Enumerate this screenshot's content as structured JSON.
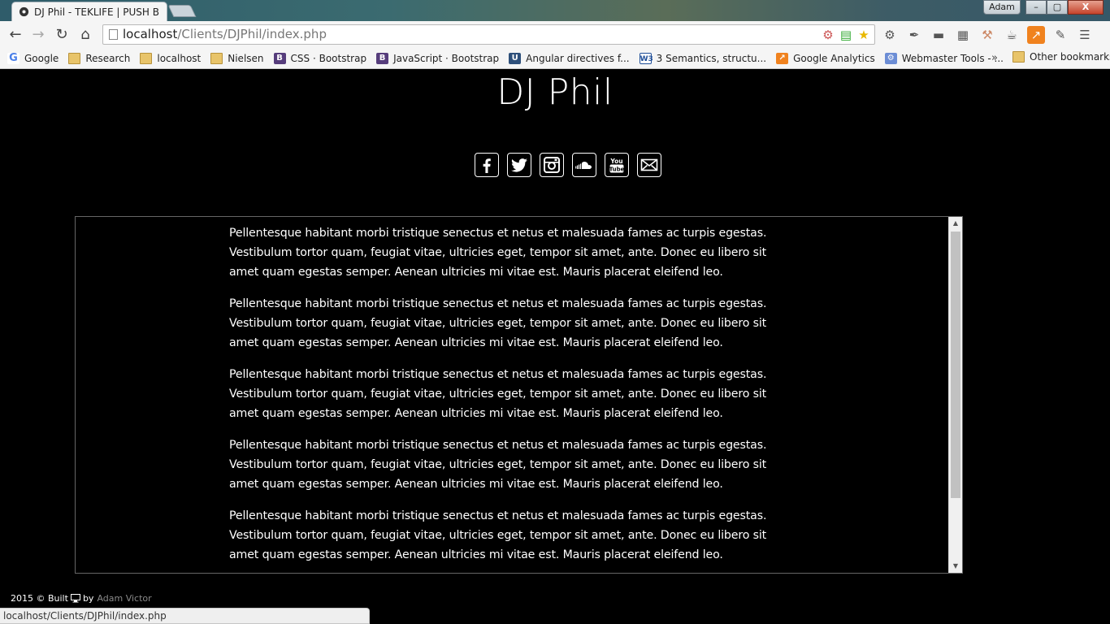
{
  "browser": {
    "tab_title": "DJ Phil - TEKLIFE | PUSH B",
    "profile_name": "Adam",
    "window_buttons": {
      "minimize": "–",
      "maximize": "▢",
      "close": "X"
    },
    "url_host": "localhost",
    "url_path": "/Clients/DJPhil/index.php",
    "bookmarks": [
      {
        "label": "Google",
        "icon": "google-icon"
      },
      {
        "label": "Research",
        "icon": "folder-icon"
      },
      {
        "label": "localhost",
        "icon": "folder-icon"
      },
      {
        "label": "Nielsen",
        "icon": "folder-icon"
      },
      {
        "label": "CSS · Bootstrap",
        "icon": "bootstrap-icon"
      },
      {
        "label": "JavaScript · Bootstrap",
        "icon": "bootstrap-icon"
      },
      {
        "label": "Angular directives f...",
        "icon": "angular-icon"
      },
      {
        "label": "3 Semantics, structu...",
        "icon": "w3-icon"
      },
      {
        "label": "Google Analytics",
        "icon": "analytics-icon"
      },
      {
        "label": "Webmaster Tools - ...",
        "icon": "webmaster-icon"
      }
    ],
    "bookmarks_overflow": "»",
    "other_bookmarks": "Other bookmarks",
    "status_url": "localhost/Clients/DJPhil/index.php"
  },
  "page": {
    "title": "DJ Phil",
    "social": [
      {
        "name": "facebook-icon",
        "glyph": "f"
      },
      {
        "name": "twitter-icon",
        "glyph": "twitter"
      },
      {
        "name": "instagram-icon",
        "glyph": "instagram"
      },
      {
        "name": "soundcloud-icon",
        "glyph": "soundcloud"
      },
      {
        "name": "youtube-icon",
        "glyph": "youtube"
      },
      {
        "name": "email-icon",
        "glyph": "mail"
      }
    ],
    "paragraphs": [
      "Pellentesque habitant morbi tristique senectus et netus et malesuada fames ac turpis egestas. Vestibulum tortor quam, feugiat vitae, ultricies eget, tempor sit amet, ante. Donec eu libero sit amet quam egestas semper. Aenean ultricies mi vitae est. Mauris placerat eleifend leo.",
      "Pellentesque habitant morbi tristique senectus et netus et malesuada fames ac turpis egestas. Vestibulum tortor quam, feugiat vitae, ultricies eget, tempor sit amet, ante. Donec eu libero sit amet quam egestas semper. Aenean ultricies mi vitae est. Mauris placerat eleifend leo.",
      "Pellentesque habitant morbi tristique senectus et netus et malesuada fames ac turpis egestas. Vestibulum tortor quam, feugiat vitae, ultricies eget, tempor sit amet, ante. Donec eu libero sit amet quam egestas semper. Aenean ultricies mi vitae est. Mauris placerat eleifend leo.",
      "Pellentesque habitant morbi tristique senectus et netus et malesuada fames ac turpis egestas. Vestibulum tortor quam, feugiat vitae, ultricies eget, tempor sit amet, ante. Donec eu libero sit amet quam egestas semper. Aenean ultricies mi vitae est. Mauris placerat eleifend leo.",
      "Pellentesque habitant morbi tristique senectus et netus et malesuada fames ac turpis egestas. Vestibulum tortor quam, feugiat vitae, ultricies eget, tempor sit amet, ante. Donec eu libero sit amet quam egestas semper. Aenean ultricies mi vitae est. Mauris placerat eleifend leo."
    ],
    "footer": {
      "prefix": "2015 © Built",
      "by": "by",
      "author": "Adam Victor"
    }
  }
}
